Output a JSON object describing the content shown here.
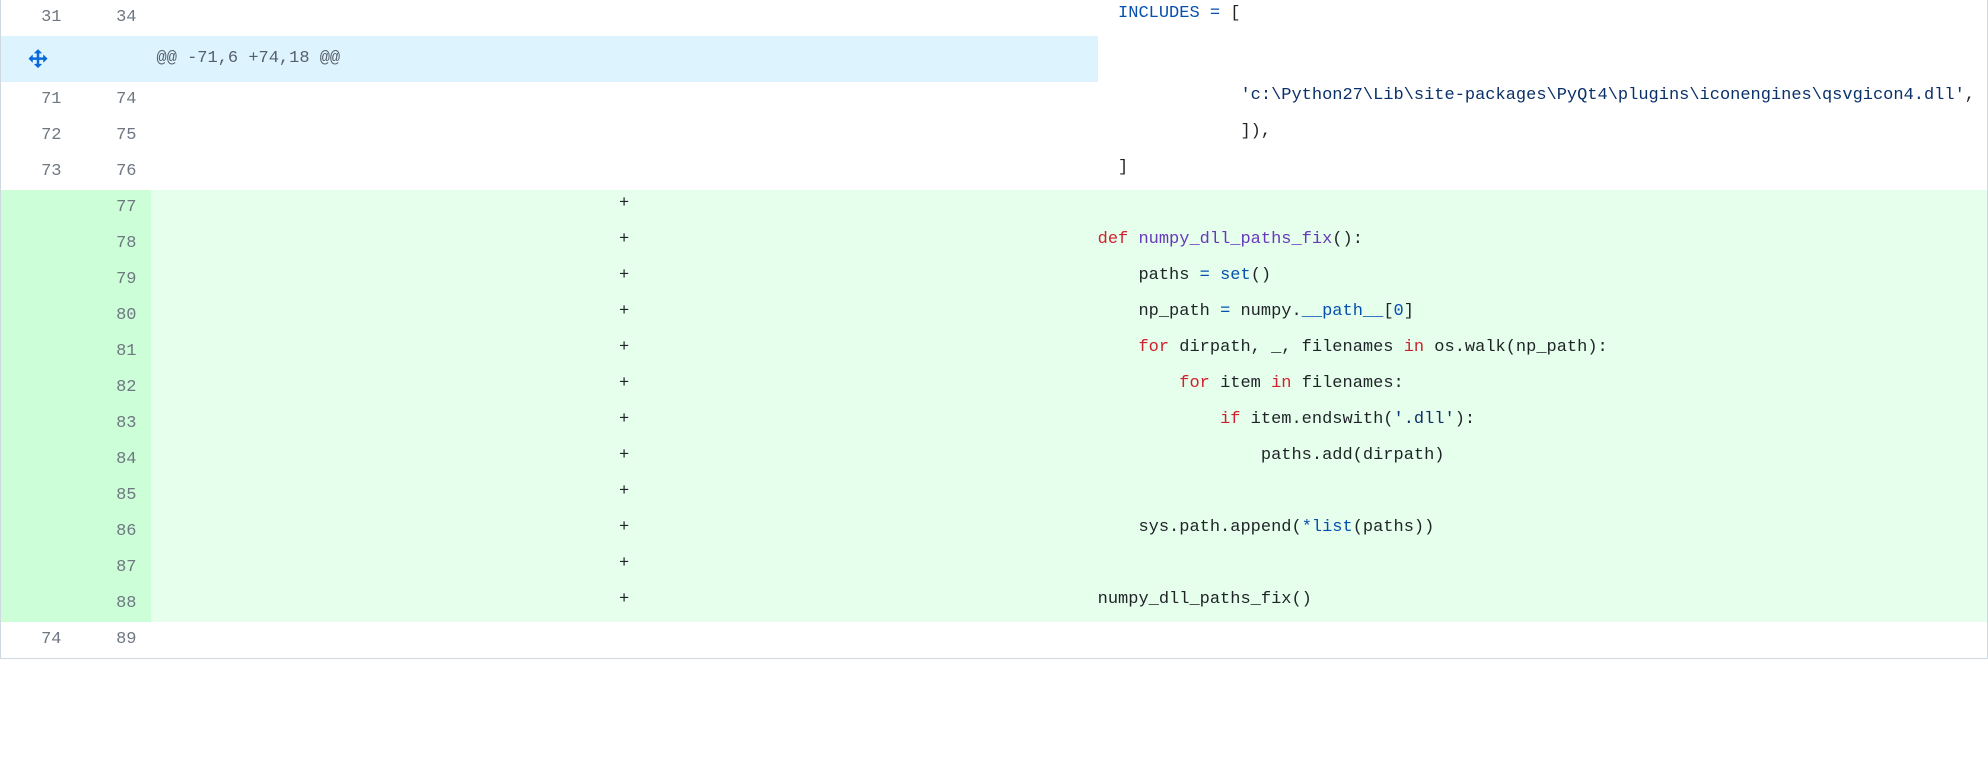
{
  "hunk_header": "@@ -71,6 +74,18 @@",
  "rows": [
    {
      "type": "context",
      "old": "31",
      "new": "34",
      "marker": "",
      "tokens": [
        {
          "t": "  ",
          "c": ""
        },
        {
          "t": "INCLUDES",
          "c": "s-const"
        },
        {
          "t": " ",
          "c": ""
        },
        {
          "t": "=",
          "c": "s-op"
        },
        {
          "t": " [",
          "c": ""
        }
      ]
    },
    {
      "type": "hunk"
    },
    {
      "type": "context",
      "old": "71",
      "new": "74",
      "marker": "",
      "tokens": [
        {
          "t": "              ",
          "c": ""
        },
        {
          "t": "'c:\\Python27\\Lib\\site-packages\\PyQt4\\plugins\\iconengines\\qsvgicon4.dll'",
          "c": "s-str"
        },
        {
          "t": ",",
          "c": ""
        }
      ]
    },
    {
      "type": "context",
      "old": "72",
      "new": "75",
      "marker": "",
      "tokens": [
        {
          "t": "              ]),",
          "c": ""
        }
      ]
    },
    {
      "type": "context",
      "old": "73",
      "new": "76",
      "marker": "",
      "tokens": [
        {
          "t": "  ]",
          "c": ""
        }
      ]
    },
    {
      "type": "addition",
      "old": "",
      "new": "77",
      "marker": "+",
      "tokens": []
    },
    {
      "type": "addition",
      "old": "",
      "new": "78",
      "marker": "+",
      "tokens": [
        {
          "t": "def",
          "c": "s-kw"
        },
        {
          "t": " ",
          "c": ""
        },
        {
          "t": "numpy_dll_paths_fix",
          "c": "s-func"
        },
        {
          "t": "():",
          "c": ""
        }
      ]
    },
    {
      "type": "addition",
      "old": "",
      "new": "79",
      "marker": "+",
      "tokens": [
        {
          "t": "    paths ",
          "c": ""
        },
        {
          "t": "=",
          "c": "s-op"
        },
        {
          "t": " ",
          "c": ""
        },
        {
          "t": "set",
          "c": "s-builtin"
        },
        {
          "t": "()",
          "c": ""
        }
      ]
    },
    {
      "type": "addition",
      "old": "",
      "new": "80",
      "marker": "+",
      "tokens": [
        {
          "t": "    np_path ",
          "c": ""
        },
        {
          "t": "=",
          "c": "s-op"
        },
        {
          "t": " numpy.",
          "c": ""
        },
        {
          "t": "__path__",
          "c": "s-dunder"
        },
        {
          "t": "[",
          "c": ""
        },
        {
          "t": "0",
          "c": "s-num"
        },
        {
          "t": "]",
          "c": ""
        }
      ]
    },
    {
      "type": "addition",
      "old": "",
      "new": "81",
      "marker": "+",
      "tokens": [
        {
          "t": "    ",
          "c": ""
        },
        {
          "t": "for",
          "c": "s-kw"
        },
        {
          "t": " dirpath, _, filenames ",
          "c": ""
        },
        {
          "t": "in",
          "c": "s-kw"
        },
        {
          "t": " os.walk(np_path):",
          "c": ""
        }
      ]
    },
    {
      "type": "addition",
      "old": "",
      "new": "82",
      "marker": "+",
      "tokens": [
        {
          "t": "        ",
          "c": ""
        },
        {
          "t": "for",
          "c": "s-kw"
        },
        {
          "t": " item ",
          "c": ""
        },
        {
          "t": "in",
          "c": "s-kw"
        },
        {
          "t": " filenames:",
          "c": ""
        }
      ]
    },
    {
      "type": "addition",
      "old": "",
      "new": "83",
      "marker": "+",
      "tokens": [
        {
          "t": "            ",
          "c": ""
        },
        {
          "t": "if",
          "c": "s-kw"
        },
        {
          "t": " item.endswith(",
          "c": ""
        },
        {
          "t": "'.dll'",
          "c": "s-str"
        },
        {
          "t": "):",
          "c": ""
        }
      ]
    },
    {
      "type": "addition",
      "old": "",
      "new": "84",
      "marker": "+",
      "tokens": [
        {
          "t": "                paths.add(dirpath)",
          "c": ""
        }
      ]
    },
    {
      "type": "addition",
      "old": "",
      "new": "85",
      "marker": "+",
      "tokens": []
    },
    {
      "type": "addition",
      "old": "",
      "new": "86",
      "marker": "+",
      "tokens": [
        {
          "t": "    sys.path.append(",
          "c": ""
        },
        {
          "t": "*",
          "c": "s-op"
        },
        {
          "t": "list",
          "c": "s-builtin"
        },
        {
          "t": "(paths))",
          "c": ""
        }
      ]
    },
    {
      "type": "addition",
      "old": "",
      "new": "87",
      "marker": "+",
      "tokens": []
    },
    {
      "type": "addition",
      "old": "",
      "new": "88",
      "marker": "+",
      "tokens": [
        {
          "t": "numpy_dll_paths_fix()",
          "c": ""
        }
      ]
    },
    {
      "type": "context",
      "old": "74",
      "new": "89",
      "marker": "",
      "tokens": []
    }
  ]
}
